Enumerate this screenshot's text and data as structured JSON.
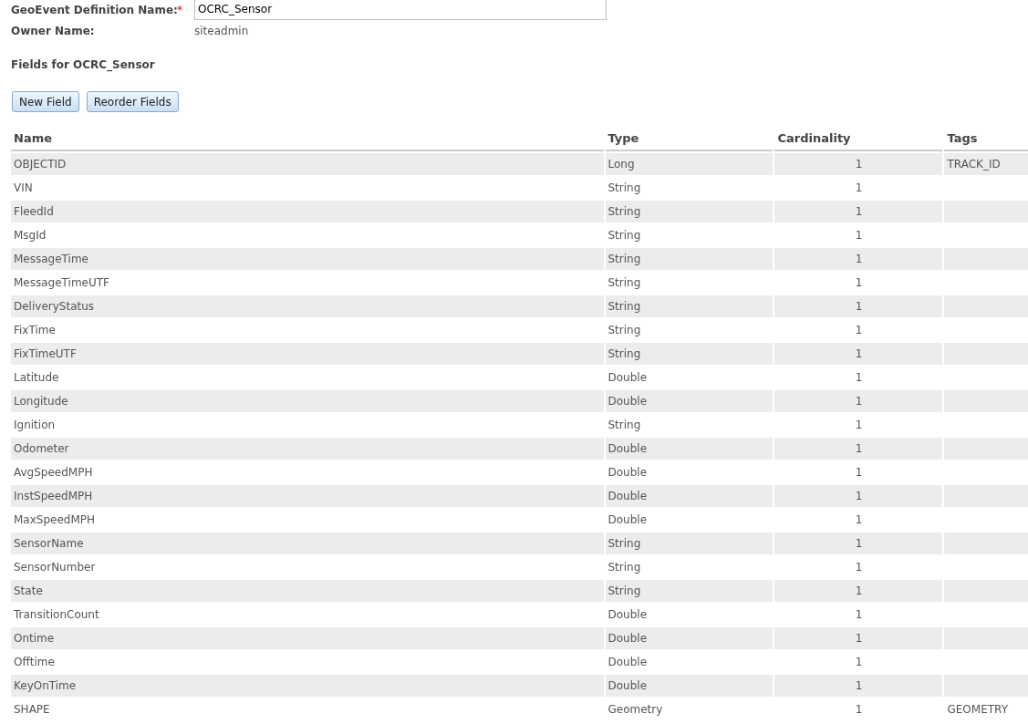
{
  "definition_name": {
    "label": "GeoEvent Definition Name:",
    "required_mark": "*",
    "value": "OCRC_Sensor"
  },
  "owner": {
    "label": "Owner Name:",
    "value": "siteadmin"
  },
  "fields_heading": "Fields for OCRC_Sensor",
  "buttons": [
    "New Field",
    "Reorder Fields"
  ],
  "table": {
    "columns": [
      "Name",
      "Type",
      "Cardinality",
      "Tags"
    ],
    "rows": [
      {
        "name": "OBJECTID",
        "type": "Long",
        "cardinality": "1",
        "tags": "TRACK_ID"
      },
      {
        "name": "VIN",
        "type": "String",
        "cardinality": "1"
      },
      {
        "name": "FleedId",
        "type": "String",
        "cardinality": "1"
      },
      {
        "name": "MsgId",
        "type": "String",
        "cardinality": "1"
      },
      {
        "name": "MessageTime",
        "type": "String",
        "cardinality": "1"
      },
      {
        "name": "MessageTimeUTF",
        "type": "String",
        "cardinality": "1"
      },
      {
        "name": "DeliveryStatus",
        "type": "String",
        "cardinality": "1"
      },
      {
        "name": "FixTime",
        "type": "String",
        "cardinality": "1"
      },
      {
        "name": "FixTimeUTF",
        "type": "String",
        "cardinality": "1"
      },
      {
        "name": "Latitude",
        "type": "Double",
        "cardinality": "1"
      },
      {
        "name": "Longitude",
        "type": "Double",
        "cardinality": "1"
      },
      {
        "name": "Ignition",
        "type": "String",
        "cardinality": "1"
      },
      {
        "name": "Odometer",
        "type": "Double",
        "cardinality": "1"
      },
      {
        "name": "AvgSpeedMPH",
        "type": "Double",
        "cardinality": "1"
      },
      {
        "name": "InstSpeedMPH",
        "type": "Double",
        "cardinality": "1"
      },
      {
        "name": "MaxSpeedMPH",
        "type": "Double",
        "cardinality": "1"
      },
      {
        "name": "SensorName",
        "type": "String",
        "cardinality": "1"
      },
      {
        "name": "SensorNumber",
        "type": "String",
        "cardinality": "1"
      },
      {
        "name": "State",
        "type": "String",
        "cardinality": "1"
      },
      {
        "name": "TransitionCount",
        "type": "Double",
        "cardinality": "1"
      },
      {
        "name": "Ontime",
        "type": "Double",
        "cardinality": "1"
      },
      {
        "name": "Offtime",
        "type": "Double",
        "cardinality": "1"
      },
      {
        "name": "KeyOnTime",
        "type": "Double",
        "cardinality": "1"
      },
      {
        "name": "SHAPE",
        "type": "Geometry",
        "cardinality": "1",
        "tags": "GEOMETRY"
      }
    ]
  }
}
